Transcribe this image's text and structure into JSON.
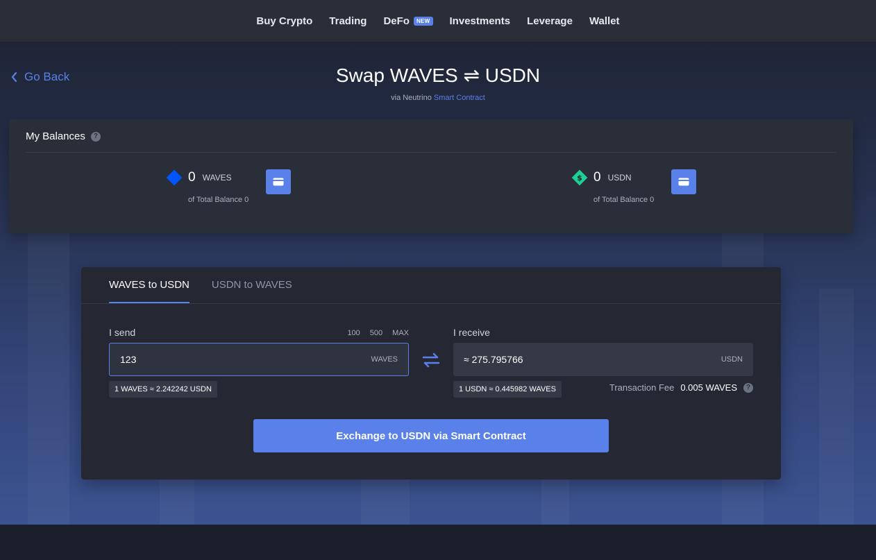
{
  "nav": {
    "items": [
      {
        "label": "Buy Crypto"
      },
      {
        "label": "Trading"
      },
      {
        "label": "DeFo",
        "badge": "NEW"
      },
      {
        "label": "Investments"
      },
      {
        "label": "Leverage"
      },
      {
        "label": "Wallet"
      }
    ]
  },
  "header": {
    "back_label": "Go Back",
    "title": "Swap WAVES ⇌ USDN",
    "subtitle_prefix": "via Neutrino",
    "subtitle_link": "Smart Contract"
  },
  "balances": {
    "heading": "My Balances",
    "items": [
      {
        "amount": "0",
        "ticker": "WAVES",
        "total": "of Total Balance 0",
        "icon": "waves-icon"
      },
      {
        "amount": "0",
        "ticker": "USDN",
        "total": "of Total Balance 0",
        "icon": "usdn-icon"
      }
    ]
  },
  "swap": {
    "tabs": [
      {
        "label": "WAVES to USDN",
        "active": true
      },
      {
        "label": "USDN to WAVES",
        "active": false
      }
    ],
    "send_label": "I send",
    "receive_label": "I receive",
    "quick_amounts": [
      "100",
      "500",
      "MAX"
    ],
    "send_value": "123",
    "send_unit": "WAVES",
    "receive_value": "≈ 275.795766",
    "receive_unit": "USDN",
    "send_rate": "1 WAVES ≈ 2.242242 USDN",
    "receive_rate": "1 USDN ≈ 0.445982 WAVES",
    "fee_label": "Transaction Fee",
    "fee_value": "0.005 WAVES",
    "button_label": "Exchange to USDN via Smart Contract"
  },
  "colors": {
    "accent": "#5a81ea",
    "panel": "#252833",
    "topbar": "#2a2e39",
    "waves": "#0055ff",
    "usdn": "#1fcf97"
  }
}
